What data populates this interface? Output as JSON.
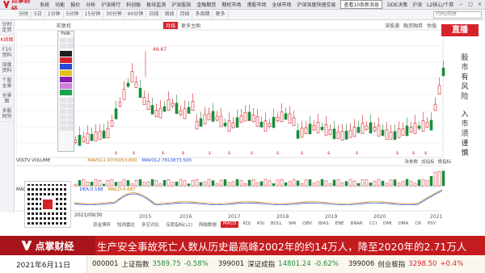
{
  "app": {
    "logo": "点掌财经",
    "menu": [
      "系统",
      "功能",
      "报价",
      "分析",
      "沪深排行",
      "科创板",
      "板块监测",
      "沪深股指",
      "金融期货",
      "期权市场",
      "港股市场",
      "全球市场",
      "沪深深度",
      "定制版面",
      "帮助"
    ],
    "quick_search": "快速交易",
    "notice": "查看10条新消息",
    "right_items": [
      "DDE决策",
      "沪深",
      "L2核心/个券"
    ],
    "win_controls": [
      "－",
      "□",
      "×"
    ]
  },
  "toolbar": {
    "items": [
      "分时",
      "5日",
      "1分钟",
      "5分钟",
      "15分钟",
      "30分钟",
      "60分钟",
      "日线",
      "周线",
      "月线",
      "多周期",
      "更多"
    ],
    "search_placeholder": "代码/简拼"
  },
  "sidebar": {
    "items": [
      "分时走势",
      "K线图",
      "F10资料",
      "深度资料",
      "个股全景",
      "全景图",
      "多股同列"
    ],
    "active_index": 1
  },
  "chart_header": {
    "stock_label": "前复权",
    "period_tab": "月线",
    "more": "更多主图",
    "right_links": [
      "深股通",
      "融资融券",
      "估值"
    ],
    "live": "直播"
  },
  "toolpanel": {
    "title": "Fellk",
    "swatch_colors": [
      "#1e1e1e",
      "#d4232b",
      "#2a48d4",
      "#e3c21b",
      "#8a1fb0",
      "#d07fd8",
      "#1aa34a"
    ]
  },
  "price_annotation": "46.67",
  "side_news": [
    "股",
    "市",
    "有",
    "风",
    "险",
    "入",
    "市",
    "须",
    "谨",
    "慎"
  ],
  "volume": {
    "label": "VOLTV VOLUME",
    "ma1": "MAVOL1:9705053.800",
    "ma2": "MAVOL2:7813873.500",
    "tools": [
      "改参数",
      "加指标",
      "换指标"
    ]
  },
  "macd": {
    "label": "MACD",
    "dea": "DEA:0.188",
    "macd": "MACD:4.687"
  },
  "date_label": "2021/09/30",
  "x_axis_years": [
    "2015",
    "2016",
    "2017",
    "2018",
    "2019",
    "2020",
    "2021"
  ],
  "indicator_tabs": [
    "资金博弈",
    "短线雷达",
    "多空对比",
    "深度指标[L2]",
    "两融数据",
    "MACD",
    "KDJ",
    "RSI",
    "BOLL",
    "WR",
    "OBV",
    "BIAS",
    "ENE",
    "BRAR",
    "CCI",
    "DMI",
    "DMA",
    "CR",
    "PSY"
  ],
  "active_indicator": "MACD",
  "banner": {
    "logo": "点掌财经",
    "text": "生产安全事故死亡人数从历史最高峰2002年的约14万人，降至2020年的2.71万人"
  },
  "ticker": {
    "date": "2021年6月11日",
    "items": [
      {
        "code": "000001",
        "name": "上证指数",
        "price": "3589.75",
        "change": "-0.58%",
        "dir": "down"
      },
      {
        "code": "399001",
        "name": "深证成指",
        "price": "14801.24",
        "change": "-0.62%",
        "dir": "down"
      },
      {
        "code": "399006",
        "name": "创业板指",
        "price": "3298.50",
        "change": "+0.4%",
        "dir": "up"
      }
    ]
  }
}
